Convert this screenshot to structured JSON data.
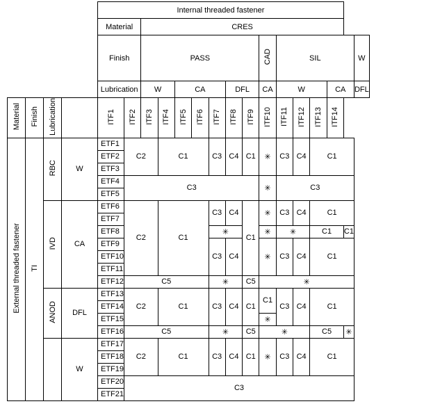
{
  "top": {
    "title": "Internal threaded fastener",
    "material_label": "Material",
    "material_value": "CRES",
    "finish_label": "Finish",
    "finishes": [
      "PASS",
      "CAD",
      "SIL",
      "W"
    ],
    "lubrication_label": "Lubrication",
    "lubs": [
      "W",
      "CA",
      "DFL",
      "CA",
      "W",
      "CA",
      "DFL"
    ],
    "itf": [
      "ITF1",
      "ITF2",
      "ITF3",
      "ITF4",
      "ITF5",
      "ITF6",
      "ITF7",
      "ITF8",
      "ITF9",
      "ITF10",
      "ITF11",
      "ITF12",
      "ITF13",
      "ITF14"
    ]
  },
  "side": {
    "title": "External threaded fastener",
    "material_label": "Material",
    "finish_label": "Finish",
    "lubrication_label": "Lubrication",
    "material_value": "TI",
    "groups": [
      {
        "finish": "RBC",
        "lub": "W",
        "etf": [
          "ETF1",
          "ETF2",
          "ETF3",
          "ETF4",
          "ETF5"
        ]
      },
      {
        "finish": "IVD",
        "lub": "CA",
        "etf": [
          "ETF6",
          "ETF7",
          "ETF8",
          "ETF9",
          "ETF10",
          "ETF11",
          "ETF12"
        ]
      },
      {
        "finish": "ANOD",
        "lub": "DFL",
        "etf": [
          "ETF13",
          "ETF14",
          "ETF15",
          "ETF16"
        ]
      },
      {
        "finish": "",
        "lub": "W",
        "etf": [
          "ETF17",
          "ETF18",
          "ETF19",
          "ETF20",
          "ETF21"
        ]
      }
    ]
  },
  "sym": {
    "c1": "C1",
    "c2": "C2",
    "c3": "C3",
    "c4": "C4",
    "c5": "C5",
    "ast": "✳︎"
  },
  "chart_data": {
    "type": "table",
    "title": "Compatibility matrix of External vs Internal threaded fasteners",
    "columns": [
      "ITF1",
      "ITF2",
      "ITF3",
      "ITF4",
      "ITF5",
      "ITF6",
      "ITF7",
      "ITF8",
      "ITF9",
      "ITF10",
      "ITF11",
      "ITF12",
      "ITF13",
      "ITF14"
    ],
    "rows": [
      "ETF1",
      "ETF2",
      "ETF3",
      "ETF4",
      "ETF5",
      "ETF6",
      "ETF7",
      "ETF8",
      "ETF9",
      "ETF10",
      "ETF11",
      "ETF12",
      "ETF13",
      "ETF14",
      "ETF15",
      "ETF16",
      "ETF17",
      "ETF18",
      "ETF19",
      "ETF20",
      "ETF21"
    ],
    "row_meta": [
      {
        "material": "TI",
        "finish": "RBC",
        "lub": "W"
      },
      {
        "material": "TI",
        "finish": "RBC",
        "lub": "W"
      },
      {
        "material": "TI",
        "finish": "RBC",
        "lub": "W"
      },
      {
        "material": "TI",
        "finish": "RBC",
        "lub": "W"
      },
      {
        "material": "TI",
        "finish": "RBC",
        "lub": "W"
      },
      {
        "material": "TI",
        "finish": "IVD",
        "lub": "CA"
      },
      {
        "material": "TI",
        "finish": "IVD",
        "lub": "CA"
      },
      {
        "material": "TI",
        "finish": "IVD",
        "lub": "CA"
      },
      {
        "material": "TI",
        "finish": "IVD",
        "lub": "CA"
      },
      {
        "material": "TI",
        "finish": "IVD",
        "lub": "CA"
      },
      {
        "material": "TI",
        "finish": "IVD",
        "lub": "CA"
      },
      {
        "material": "TI",
        "finish": "IVD",
        "lub": "CA"
      },
      {
        "material": "TI",
        "finish": "ANOD",
        "lub": "DFL"
      },
      {
        "material": "TI",
        "finish": "ANOD",
        "lub": "DFL"
      },
      {
        "material": "TI",
        "finish": "ANOD",
        "lub": "DFL"
      },
      {
        "material": "TI",
        "finish": "ANOD",
        "lub": "DFL"
      },
      {
        "material": "TI",
        "finish": "",
        "lub": "W"
      },
      {
        "material": "TI",
        "finish": "",
        "lub": "W"
      },
      {
        "material": "TI",
        "finish": "",
        "lub": "W"
      },
      {
        "material": "TI",
        "finish": "",
        "lub": "W"
      },
      {
        "material": "TI",
        "finish": "",
        "lub": "W"
      }
    ],
    "col_meta": [
      {
        "material": "CRES",
        "finish": "PASS",
        "lub": "W"
      },
      {
        "material": "CRES",
        "finish": "PASS",
        "lub": "W"
      },
      {
        "material": "CRES",
        "finish": "PASS",
        "lub": "CA"
      },
      {
        "material": "CRES",
        "finish": "PASS",
        "lub": "CA"
      },
      {
        "material": "CRES",
        "finish": "PASS",
        "lub": "CA"
      },
      {
        "material": "CRES",
        "finish": "PASS",
        "lub": "DFL"
      },
      {
        "material": "CRES",
        "finish": "PASS",
        "lub": "DFL"
      },
      {
        "material": "CRES",
        "finish": "CAD",
        "lub": "CA"
      },
      {
        "material": "CRES",
        "finish": "SIL",
        "lub": "W"
      },
      {
        "material": "CRES",
        "finish": "SIL",
        "lub": "W"
      },
      {
        "material": "CRES",
        "finish": "SIL",
        "lub": "W"
      },
      {
        "material": "CRES",
        "finish": "SIL",
        "lub": "CA"
      },
      {
        "material": "CRES",
        "finish": "SIL",
        "lub": "CA"
      },
      {
        "material": "CRES",
        "finish": "W",
        "lub": "DFL"
      }
    ],
    "values": [
      [
        "C2",
        "C2",
        "C1",
        "C1",
        "C1",
        "C3",
        "C4",
        "C1",
        "*",
        "C3",
        "C4",
        "C1",
        "C1",
        "C1"
      ],
      [
        "C2",
        "C2",
        "C1",
        "C1",
        "C1",
        "C3",
        "C4",
        "C1",
        "*",
        "C3",
        "C4",
        "C1",
        "C1",
        "C1"
      ],
      [
        "C2",
        "C2",
        "C1",
        "C1",
        "C1",
        "C3",
        "C4",
        "C1",
        "*",
        "C3",
        "C4",
        "C1",
        "C1",
        "C1"
      ],
      [
        "C3",
        "C3",
        "C3",
        "C3",
        "C3",
        "C3",
        "C3",
        "C3",
        "*",
        "C3",
        "C3",
        "C3",
        "C3",
        "C3"
      ],
      [
        "C3",
        "C3",
        "C3",
        "C3",
        "C3",
        "C3",
        "C3",
        "C3",
        "*",
        "C3",
        "C3",
        "C3",
        "C3",
        "C3"
      ],
      [
        "C2",
        "C2",
        "C1",
        "C1",
        "C1",
        "C3",
        "C4",
        "C1",
        "*",
        "C3",
        "C4",
        "C1",
        "C1",
        "C1"
      ],
      [
        "C2",
        "C2",
        "C1",
        "C1",
        "C1",
        "C3",
        "C4",
        "C1",
        "*",
        "C3",
        "C4",
        "C1",
        "C1",
        "C1"
      ],
      [
        "C2",
        "C2",
        "C1",
        "C1",
        "C1",
        "*",
        "*",
        "C1",
        "*",
        "*",
        "*",
        "C1",
        "C1",
        "C1"
      ],
      [
        "C2",
        "C2",
        "C1",
        "C1",
        "C1",
        "C3",
        "C4",
        "C1",
        "*",
        "C3",
        "C4",
        "C1",
        "C1",
        "C1"
      ],
      [
        "C2",
        "C2",
        "C1",
        "C1",
        "C1",
        "C3",
        "C4",
        "C1",
        "*",
        "C3",
        "C4",
        "C1",
        "C1",
        "C1"
      ],
      [
        "C2",
        "C2",
        "C1",
        "C1",
        "C1",
        "C3",
        "C4",
        "C1",
        "*",
        "C3",
        "C4",
        "C1",
        "C1",
        "C1"
      ],
      [
        "C5",
        "C5",
        "C5",
        "C5",
        "C5",
        "*",
        "*",
        "C5",
        "*",
        "*",
        "*",
        "*",
        "*",
        "*"
      ],
      [
        "C2",
        "C2",
        "C1",
        "C1",
        "C1",
        "C3",
        "C4",
        "C1",
        "C1",
        "C3",
        "C4",
        "C1",
        "C1",
        "C1"
      ],
      [
        "C2",
        "C2",
        "C1",
        "C1",
        "C1",
        "C3",
        "C4",
        "C1",
        "C1",
        "C3",
        "C4",
        "C1",
        "C1",
        "C1"
      ],
      [
        "C2",
        "C2",
        "C1",
        "C1",
        "C1",
        "C3",
        "C4",
        "C1",
        "*",
        "C3",
        "C4",
        "C1",
        "C1",
        "C1"
      ],
      [
        "C5",
        "C5",
        "C5",
        "C5",
        "C5",
        "*",
        "*",
        "C5",
        "*",
        "*",
        "*",
        "C5",
        "C5",
        "*"
      ],
      [
        "C2",
        "C2",
        "C1",
        "C1",
        "C1",
        "C3",
        "C4",
        "C1",
        "*",
        "C3",
        "C4",
        "C1",
        "C1",
        "C1"
      ],
      [
        "C2",
        "C2",
        "C1",
        "C1",
        "C1",
        "C3",
        "C4",
        "C1",
        "*",
        "C3",
        "C4",
        "C1",
        "C1",
        "C1"
      ],
      [
        "C2",
        "C2",
        "C1",
        "C1",
        "C1",
        "C3",
        "C4",
        "C1",
        "*",
        "C3",
        "C4",
        "C1",
        "C1",
        "C1"
      ],
      [
        "C3",
        "C3",
        "C3",
        "C3",
        "C3",
        "C3",
        "C3",
        "C3",
        "C3",
        "C3",
        "C3",
        "C3",
        "C3",
        "C3"
      ],
      [
        "C3",
        "C3",
        "C3",
        "C3",
        "C3",
        "C3",
        "C3",
        "C3",
        "C3",
        "C3",
        "C3",
        "C3",
        "C3",
        "C3"
      ]
    ]
  }
}
